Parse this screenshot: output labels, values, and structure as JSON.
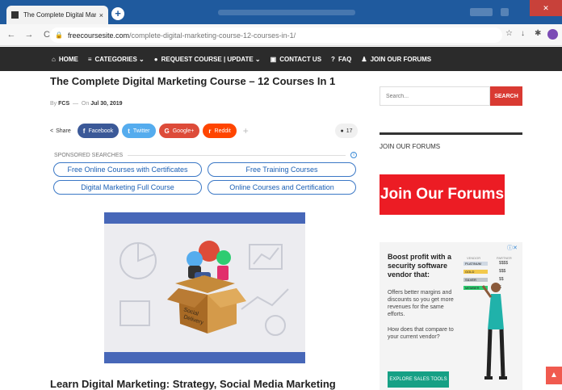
{
  "browser": {
    "tab_title": "The Complete Digital Marketing",
    "tab_close": "×",
    "new_tab": "+",
    "nav_back": "←",
    "nav_forward": "→",
    "nav_reload": "C",
    "lock": "🔒",
    "url_host": "freecoursesite.com",
    "url_path": "/complete-digital-marketing-course-12-courses-in-1/",
    "star": "☆",
    "download": "↓",
    "extension": "✱"
  },
  "site_nav": {
    "items": [
      {
        "icon": "⌂",
        "label": "HOME"
      },
      {
        "icon": "≡",
        "label": "CATEGORIES ⌄"
      },
      {
        "icon": "●",
        "label": "REQUEST COURSE | UPDATE ⌄"
      },
      {
        "icon": "▣",
        "label": "CONTACT US"
      },
      {
        "icon": "?",
        "label": "FAQ"
      },
      {
        "icon": "♟",
        "label": "JOIN OUR FORUMS"
      }
    ]
  },
  "article": {
    "title": "The Complete Digital Marketing Course – 12 Courses In 1",
    "by_label": "By",
    "author": "FCS",
    "sep": "—",
    "on_label": "On",
    "date": "Jul 30, 2019",
    "subheading": "Learn Digital Marketing: Strategy, Social Media Marketing"
  },
  "share": {
    "label": "Share",
    "buttons": [
      {
        "icon": "f",
        "label": "Facebook",
        "color": "#3b5998"
      },
      {
        "icon": "t",
        "label": "Twitter",
        "color": "#55acee"
      },
      {
        "icon": "G",
        "label": "Google+",
        "color": "#dd4b39"
      },
      {
        "icon": "r",
        "label": "Reddit",
        "color": "#ff4500"
      }
    ],
    "more": "+",
    "comment_count": "17"
  },
  "sponsored": {
    "label": "SPONSORED SEARCHES",
    "info": "i",
    "links": [
      "Free Online Courses with Certificates",
      "Free Training Courses",
      "Digital Marketing Full Course",
      "Online Courses and Certification"
    ]
  },
  "sidebar": {
    "search_placeholder": "Search...",
    "search_button": "SEARCH",
    "section_heading": "JOIN OUR FORUMS",
    "banner_text": "Join Our Forums"
  },
  "ad": {
    "adchoices": "ⓘ✕",
    "headline": "Boost profit with a security software vendor that:",
    "para1": "Offers better margins and discounts so you get more revenues for the same efforts.",
    "para2": "How does that compare to your current vendor?",
    "cta": "EXPLORE SALES TOOLS",
    "col1": "VENDOR",
    "col2": "PARTNER",
    "tiers": [
      {
        "name": "PLATINUM",
        "color": "#cfd8e3",
        "value": "$$$$"
      },
      {
        "name": "GOLD",
        "color": "#f2c94c",
        "value": "$$$"
      },
      {
        "name": "SILVER",
        "color": "#c0c6cc",
        "value": "$$"
      },
      {
        "name": "MEMBER",
        "color": "#2ecc71",
        "value": "$"
      }
    ]
  },
  "scroll_top": "▲"
}
